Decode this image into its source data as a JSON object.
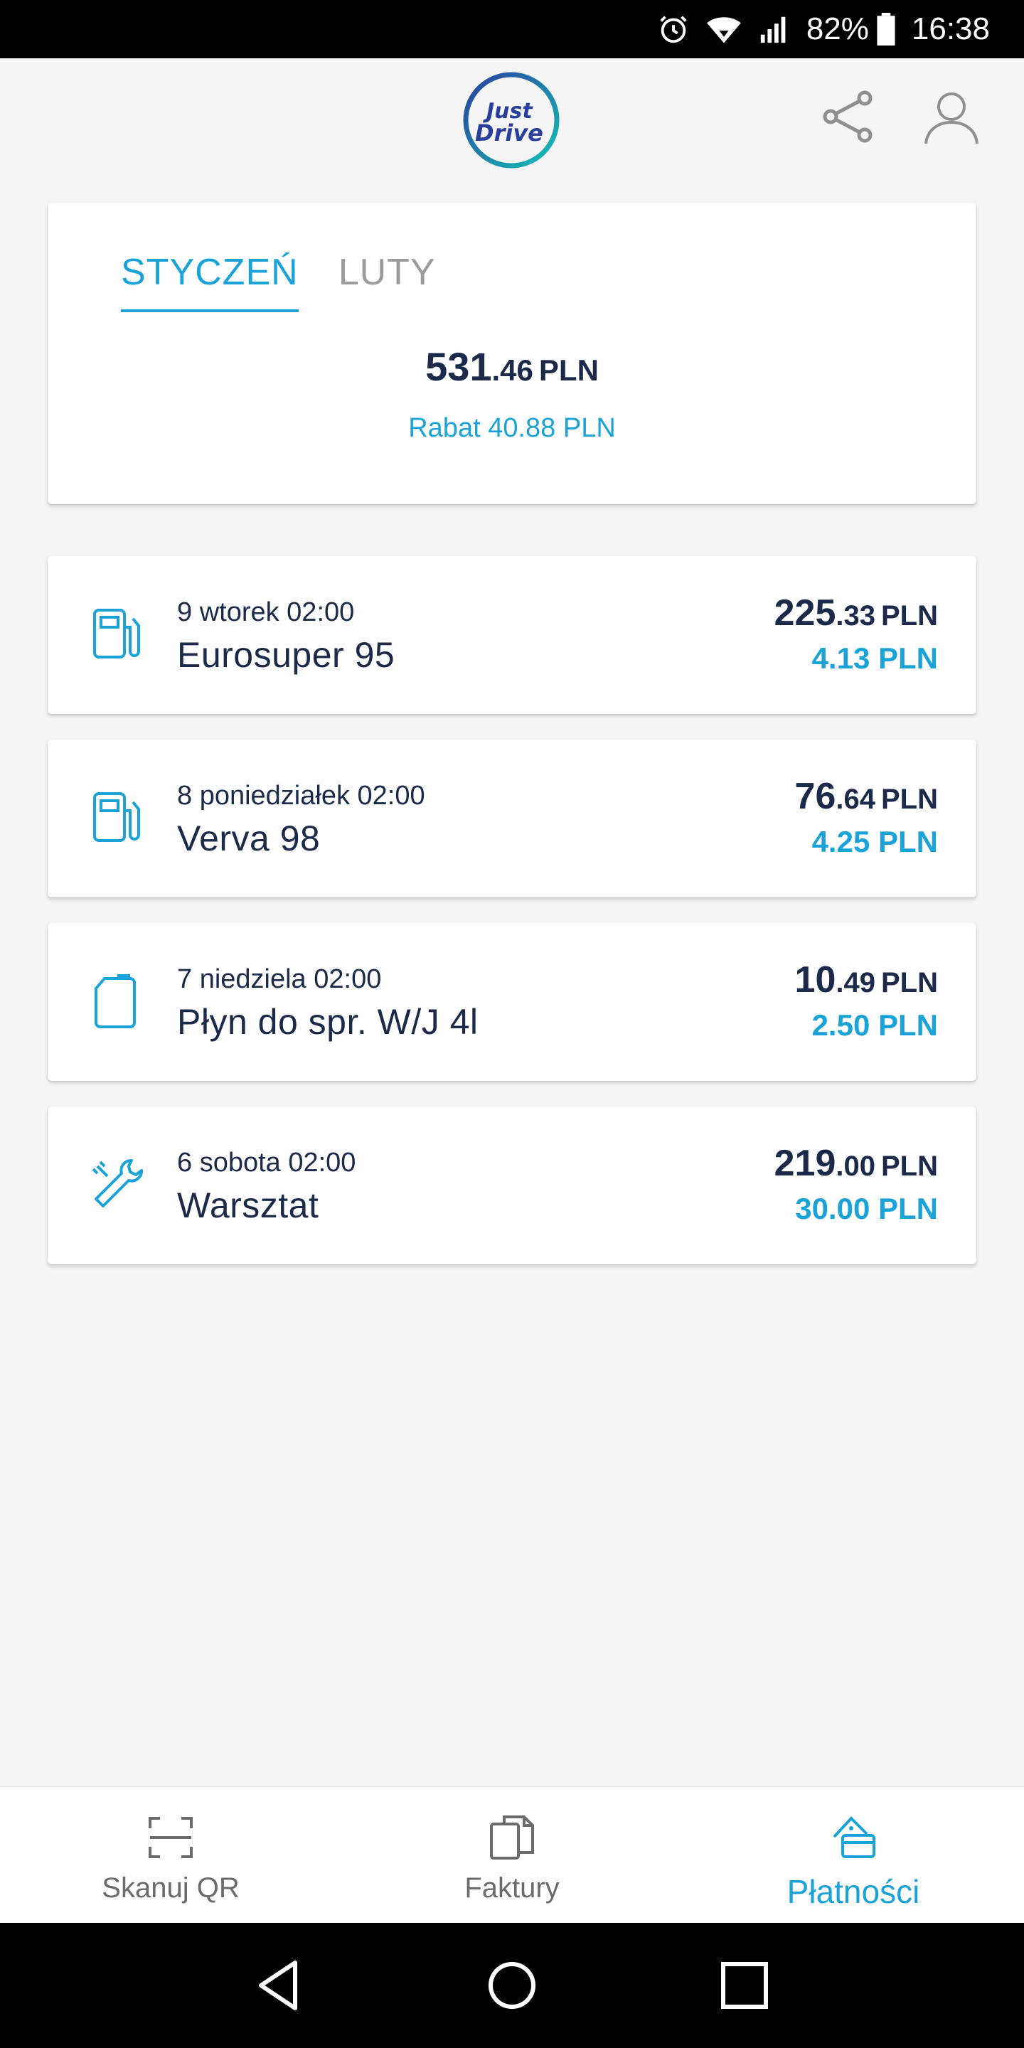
{
  "status_bar": {
    "battery": "82%",
    "time": "16:38",
    "icons": [
      "alarm-icon",
      "wifi-icon",
      "signal-icon",
      "battery-icon"
    ]
  },
  "header": {
    "logo_text_line1": "Just",
    "logo_text_line2": "Drive",
    "icons": [
      "share-icon",
      "user-icon"
    ]
  },
  "summary": {
    "tabs": [
      {
        "label": "STYCZEŃ",
        "active": true
      },
      {
        "label": "LUTY",
        "active": false
      }
    ],
    "total_int": "531",
    "total_dec": ".46",
    "total_currency": "PLN",
    "discount": "Rabat 40.88 PLN"
  },
  "transactions": [
    {
      "icon": "fuel-pump-icon",
      "date": "9 wtorek 02:00",
      "name": "Eurosuper 95",
      "amount_int": "225",
      "amount_dec": ".33",
      "currency": "PLN",
      "discount": "4.13 PLN"
    },
    {
      "icon": "fuel-pump-icon",
      "date": "8 poniedziałek 02:00",
      "name": "Verva 98",
      "amount_int": "76",
      "amount_dec": ".64",
      "currency": "PLN",
      "discount": "4.25 PLN"
    },
    {
      "icon": "canister-icon",
      "date": "7 niedziela 02:00",
      "name": "Płyn do spr. W/J 4l",
      "amount_int": "10",
      "amount_dec": ".49",
      "currency": "PLN",
      "discount": "2.50 PLN"
    },
    {
      "icon": "wrench-icon",
      "date": "6 sobota 02:00",
      "name": "Warsztat",
      "amount_int": "219",
      "amount_dec": ".00",
      "currency": "PLN",
      "discount": "30.00 PLN"
    }
  ],
  "bottom_nav": [
    {
      "label": "Skanuj QR",
      "icon": "qr-scan-icon",
      "active": false
    },
    {
      "label": "Faktury",
      "icon": "invoices-icon",
      "active": false
    },
    {
      "label": "Płatności",
      "icon": "payments-icon",
      "active": true
    }
  ],
  "colors": {
    "accent": "#1aa3d9",
    "text_dark": "#1b2a4a",
    "inactive": "#9b9b9b",
    "background": "#f5f5f5"
  }
}
